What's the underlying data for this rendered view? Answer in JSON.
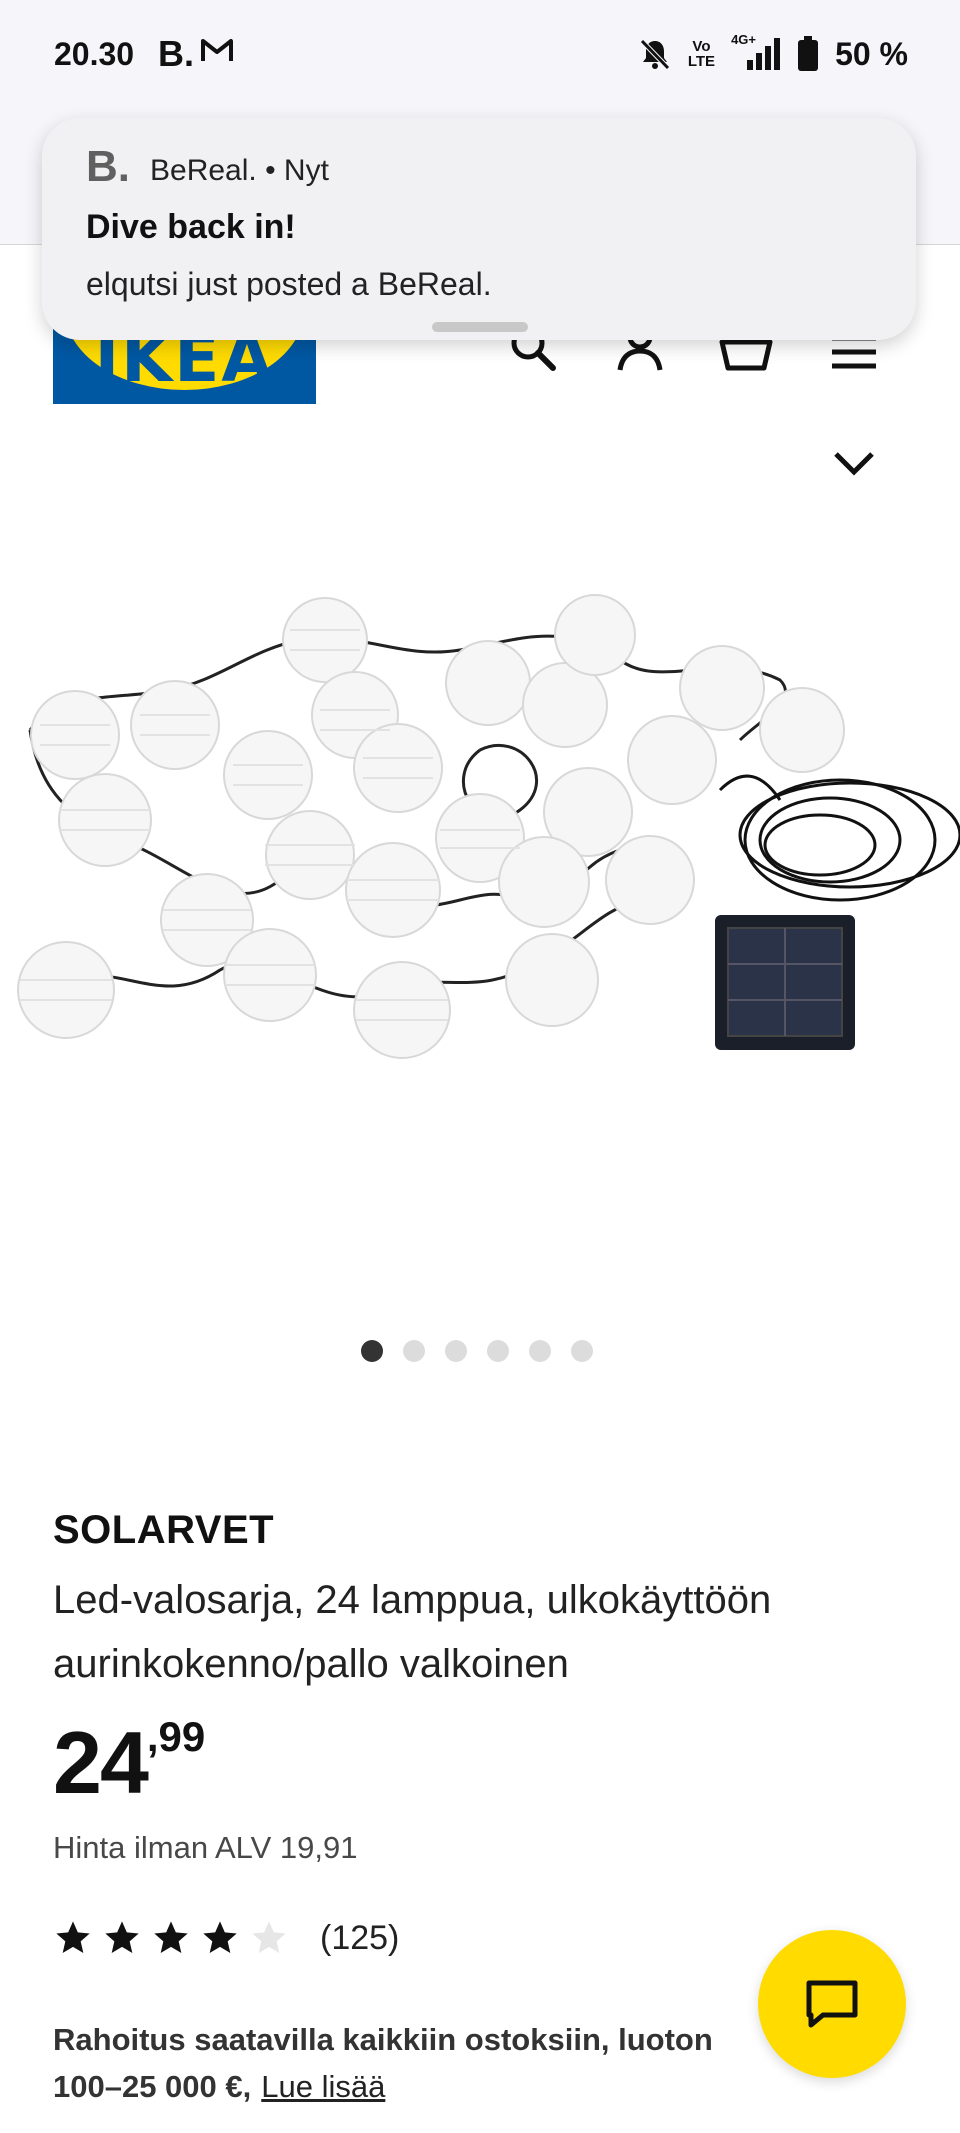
{
  "status_bar": {
    "time": "20.30",
    "app_b": "B.",
    "volte_top": "Vo",
    "volte_bottom": "LTE",
    "network": "4G+",
    "battery": "50 %"
  },
  "notification": {
    "app_icon": "B.",
    "app_line": "BeReal. • Nyt",
    "title": "Dive back in!",
    "body": "elqutsi just posted a BeReal."
  },
  "header": {
    "logo_text": "IKEA",
    "icons": [
      "search-icon",
      "profile-icon",
      "cart-icon",
      "menu-icon"
    ]
  },
  "gallery": {
    "image_count": 6,
    "active_index": 0
  },
  "product": {
    "name": "SOLARVET",
    "description": "Led-valosarja, 24 lamppua, ulkokäyttöön aurinkokenno/pallo valkoinen",
    "price_int": "24",
    "price_dec": ",99",
    "vat_text": "Hinta ilman ALV 19,91",
    "rating": 4,
    "rating_max": 5,
    "rating_count": "(125)",
    "finance_text": "Rahoitus saatavilla kaikkiin ostoksiin, luoton 100–25 000 €,",
    "finance_link": "Lue lisää"
  },
  "colors": {
    "ikea_blue": "#0058a3",
    "ikea_yellow": "#ffdb00"
  }
}
